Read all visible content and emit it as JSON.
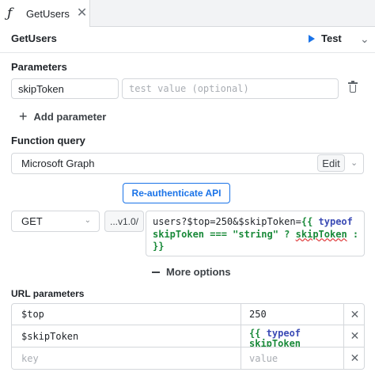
{
  "tab": {
    "icon": "function-icon",
    "label": "GetUsers",
    "close": "✕"
  },
  "header": {
    "title": "GetUsers",
    "test_label": "Test",
    "more": "⌄"
  },
  "parameters": {
    "section_label": "Parameters",
    "items": [
      {
        "name": "skipToken",
        "value_placeholder": "test value (optional)"
      }
    ],
    "add_label": "Add parameter"
  },
  "function_query": {
    "section_label": "Function query",
    "datasource": "Microsoft Graph",
    "edit_label": "Edit",
    "reauth_label": "Re-authenticate API",
    "method": "GET",
    "base": "...v1.0/",
    "query_line1_plain": "users?$top=250&$skipToken=",
    "query_tmpl_open": "{{",
    "query_kw_typeof": "typeof",
    "query_line2_a": "skipToken",
    "query_line2_b": " === ",
    "query_line2_str": "\"string\"",
    "query_line2_c": " ? ",
    "query_line2_d": "skipToken",
    "query_line2_e": " : ",
    "query_line2_str2": "\"\"",
    "query_line3": "}}"
  },
  "more_options": {
    "label": "More options"
  },
  "url_parameters": {
    "section_label": "URL parameters",
    "rows": [
      {
        "key": "$top",
        "value": "250"
      },
      {
        "key": "$skipToken",
        "value_line1_tmpl": "{{",
        "value_line1_kw": "typeof",
        "value_line2": "skipToken"
      }
    ],
    "empty_row": {
      "key_placeholder": "key",
      "value_placeholder": "value"
    }
  }
}
